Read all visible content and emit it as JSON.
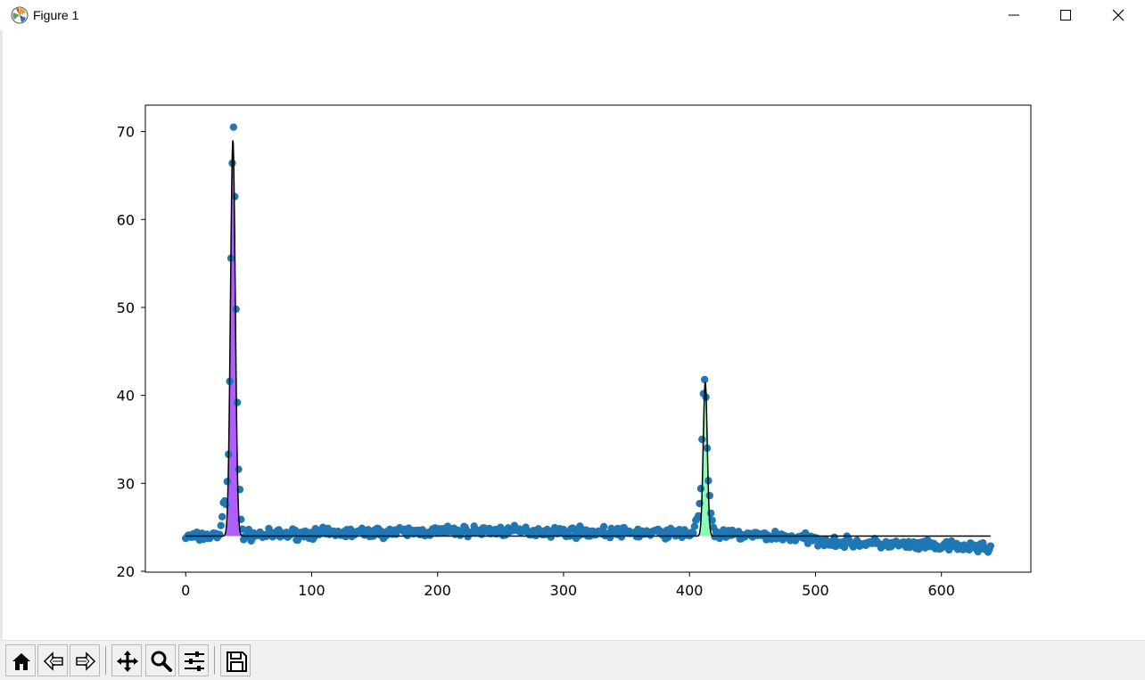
{
  "window": {
    "title": "Figure 1",
    "icon": "matplotlib-logo-icon",
    "controls": [
      "minimize-icon",
      "maximize-icon",
      "close-icon"
    ]
  },
  "toolbar": {
    "buttons": [
      "home-icon",
      "back-arrow-icon",
      "forward-arrow-icon",
      "pan-icon",
      "zoom-icon",
      "configure-subplots-icon",
      "save-icon"
    ]
  },
  "chart_data": {
    "type": "scatter",
    "title": "",
    "xlabel": "",
    "ylabel": "",
    "xlim": [
      -32,
      671
    ],
    "ylim": [
      19.9,
      73.0
    ],
    "xticks": [
      0,
      100,
      200,
      300,
      400,
      500,
      600
    ],
    "yticks": [
      20,
      30,
      40,
      50,
      60,
      70
    ],
    "xtick_labels": [
      "0",
      "100",
      "200",
      "300",
      "400",
      "500",
      "600"
    ],
    "ytick_labels": [
      "20",
      "30",
      "40",
      "50",
      "60",
      "70"
    ],
    "grid": false,
    "scatter_color": "#1f77b4",
    "fit_color": "#000000",
    "baseline": 24.0,
    "n_points": 640,
    "peaks": [
      {
        "center": 37.5,
        "amplitude": 45.0,
        "sigma": 1.9,
        "fill_color": "#a64dff"
      },
      {
        "center": 412.5,
        "amplitude": 17.5,
        "sigma": 1.6,
        "fill_color": "#7dffb0"
      }
    ],
    "peak_points": [
      {
        "x": 28,
        "y": 25.2
      },
      {
        "x": 29,
        "y": 26.2
      },
      {
        "x": 30,
        "y": 27.8
      },
      {
        "x": 31,
        "y": 28.0
      },
      {
        "x": 32,
        "y": 27.6
      },
      {
        "x": 33,
        "y": 30.2
      },
      {
        "x": 34,
        "y": 33.3
      },
      {
        "x": 35,
        "y": 41.6
      },
      {
        "x": 36,
        "y": 55.6
      },
      {
        "x": 37,
        "y": 66.4
      },
      {
        "x": 38,
        "y": 70.5
      },
      {
        "x": 39,
        "y": 62.6
      },
      {
        "x": 40,
        "y": 49.8
      },
      {
        "x": 41,
        "y": 39.2
      },
      {
        "x": 42,
        "y": 31.6
      },
      {
        "x": 43,
        "y": 29.3
      },
      {
        "x": 44,
        "y": 25.9
      },
      {
        "x": 45,
        "y": 24.8
      },
      {
        "x": 404,
        "y": 25.1
      },
      {
        "x": 405,
        "y": 25.8
      },
      {
        "x": 406,
        "y": 26.0
      },
      {
        "x": 407,
        "y": 26.3
      },
      {
        "x": 408,
        "y": 27.7
      },
      {
        "x": 409,
        "y": 29.4
      },
      {
        "x": 410,
        "y": 35.0
      },
      {
        "x": 411,
        "y": 40.2
      },
      {
        "x": 412,
        "y": 41.8
      },
      {
        "x": 413,
        "y": 39.8
      },
      {
        "x": 414,
        "y": 34.0
      },
      {
        "x": 415,
        "y": 30.3
      },
      {
        "x": 416,
        "y": 28.6
      },
      {
        "x": 417,
        "y": 26.6
      },
      {
        "x": 418,
        "y": 25.8
      },
      {
        "x": 419,
        "y": 25.0
      }
    ],
    "background_trend": [
      {
        "x": 0,
        "y": 23.9
      },
      {
        "x": 100,
        "y": 24.3
      },
      {
        "x": 240,
        "y": 24.6
      },
      {
        "x": 400,
        "y": 24.3
      },
      {
        "x": 470,
        "y": 24.0
      },
      {
        "x": 520,
        "y": 23.3
      },
      {
        "x": 600,
        "y": 22.8
      },
      {
        "x": 640,
        "y": 22.7
      }
    ],
    "noise": 0.35
  }
}
